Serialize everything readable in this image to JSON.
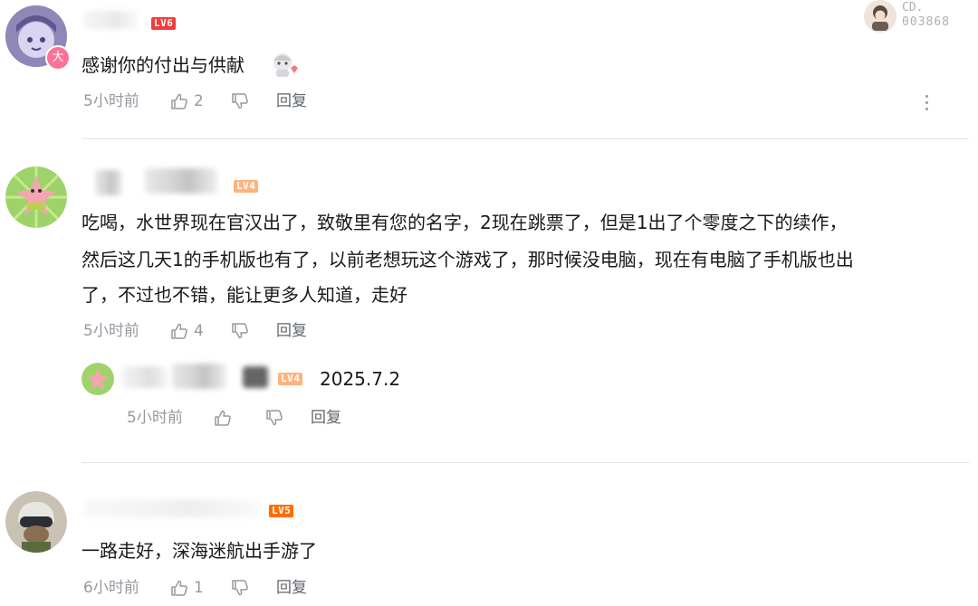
{
  "fan_badge": {
    "label": "CD.",
    "number": "003868"
  },
  "comments": [
    {
      "level": "LV6",
      "host_badge": "大",
      "text": "感谢你的付出与供献",
      "time": "5小时前",
      "likes": "2",
      "reply": "回复"
    },
    {
      "level": "LV4",
      "lines": [
        "吃喝，水世界现在官汉出了，致敬里有您的名字，2现在跳票了，但是1出了个零度之下的续作，",
        "然后这几天1的手机版也有了，以前老想玩这个游戏了，那时候没电脑，现在有电脑了手机版也出",
        "了，不过也不错，能让更多人知道，走好"
      ],
      "time": "5小时前",
      "likes": "4",
      "reply": "回复",
      "sub_reply": {
        "level": "LV4",
        "text": "2025.7.2",
        "time": "5小时前",
        "reply": "回复"
      }
    },
    {
      "level": "LV5",
      "text": "一路走好，深海迷航出手游了",
      "time": "6小时前",
      "likes": "1",
      "reply": "回复"
    }
  ],
  "colors": {
    "lv6": "#f23c3c",
    "lv5": "#ff6c00",
    "lv4": "#ffb37c",
    "meta": "#9499a0",
    "text": "#18191c",
    "host_badge": "#fb7299"
  }
}
